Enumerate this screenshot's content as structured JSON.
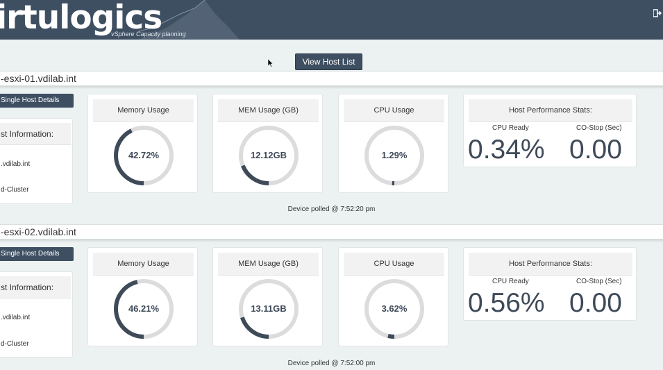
{
  "header": {
    "logo": "irtulogics",
    "tagline": "vSphere Capacity planning",
    "logout_icon": "sign-out-icon"
  },
  "toolbar": {
    "view_host_list": "View Host List"
  },
  "hosts": [
    {
      "name": "-esxi-01.vdilab.int",
      "details_button": "Single Host Details",
      "info_title": "st Information:",
      "info_line1": ".vdilab.int",
      "info_line2": "d-Cluster",
      "memory": {
        "title": "Memory Usage",
        "value": "42.72%",
        "fraction": 0.4272
      },
      "mem_gb": {
        "title": "MEM Usage (GB)",
        "value": "12.12GB",
        "fraction": 0.19
      },
      "cpu": {
        "title": "CPU Usage",
        "value": "1.29%",
        "fraction": 0.0129
      },
      "perf": {
        "title": "Host Performance Stats:",
        "cpu_ready_label": "CPU Ready",
        "cpu_ready": "0.34%",
        "costop_label": "CO-Stop (Sec)",
        "costop": "0.00"
      },
      "polled": "Device polled @ 7:52:20 pm"
    },
    {
      "name": "-esxi-02.vdilab.int",
      "details_button": "Single Host Details",
      "info_title": "st Information:",
      "info_line1": ".vdilab.int",
      "info_line2": "d-Cluster",
      "memory": {
        "title": "Memory Usage",
        "value": "46.21%",
        "fraction": 0.4621
      },
      "mem_gb": {
        "title": "MEM Usage (GB)",
        "value": "13.11GB",
        "fraction": 0.2
      },
      "cpu": {
        "title": "CPU Usage",
        "value": "3.62%",
        "fraction": 0.0362
      },
      "perf": {
        "title": "Host Performance Stats:",
        "cpu_ready_label": "CPU Ready",
        "cpu_ready": "0.56%",
        "costop_label": "CO-Stop (Sec)",
        "costop": "0.00"
      },
      "polled": "Device polled @ 7:52:00 pm"
    }
  ],
  "colors": {
    "header": "#3f4f62",
    "gauge_fill": "#3e4a58",
    "gauge_track": "#dcdcdc",
    "background": "#ecf2f2"
  }
}
